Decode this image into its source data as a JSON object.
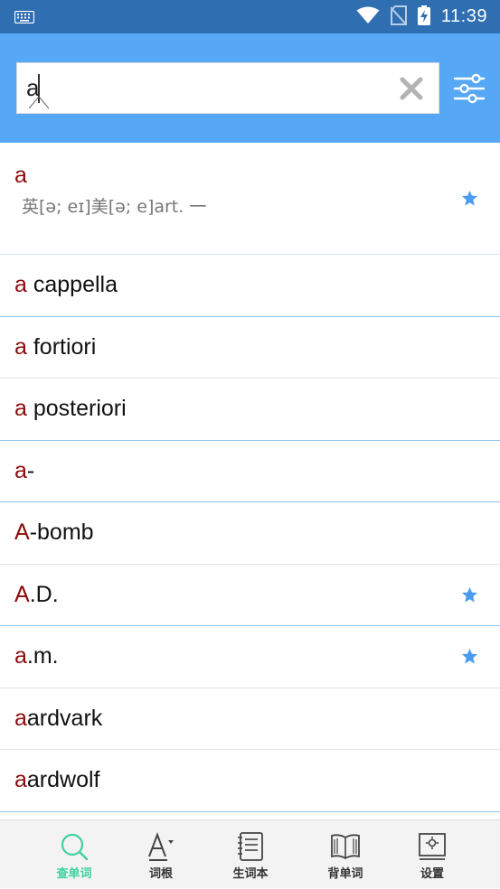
{
  "status_bar": {
    "time": "11:39"
  },
  "search": {
    "value": "a"
  },
  "results": [
    {
      "highlight": "a",
      "rest": "",
      "phonetic": "英[ə; eɪ]美[ə; e]art. 一",
      "starred": true
    },
    {
      "highlight": "a",
      "rest": " cappella",
      "starred": false
    },
    {
      "highlight": "a",
      "rest": " fortiori",
      "starred": false
    },
    {
      "highlight": "a",
      "rest": " posteriori",
      "starred": false
    },
    {
      "highlight": "a",
      "rest": "-",
      "starred": false
    },
    {
      "highlight": "A",
      "rest": "-bomb",
      "starred": false
    },
    {
      "highlight": "A",
      "rest": ".D.",
      "starred": true
    },
    {
      "highlight": "a",
      "rest": ".m.",
      "starred": true
    },
    {
      "highlight": "a",
      "rest": "ardvark",
      "starred": false
    },
    {
      "highlight": "a",
      "rest": "ardwolf",
      "starred": false
    }
  ],
  "nav": [
    {
      "label": "查单词",
      "icon": "search-icon",
      "active": true
    },
    {
      "label": "词根",
      "icon": "word-root-icon",
      "active": false
    },
    {
      "label": "生词本",
      "icon": "notebook-icon",
      "active": false
    },
    {
      "label": "背单词",
      "icon": "book-icon",
      "active": false
    },
    {
      "label": "设置",
      "icon": "settings-icon",
      "active": false
    }
  ],
  "colors": {
    "status_bar": "#2f6eb1",
    "header": "#56a8f6",
    "highlight": "#8b0a0a",
    "star": "#4b9cf0",
    "nav_active": "#3fd1a0"
  }
}
